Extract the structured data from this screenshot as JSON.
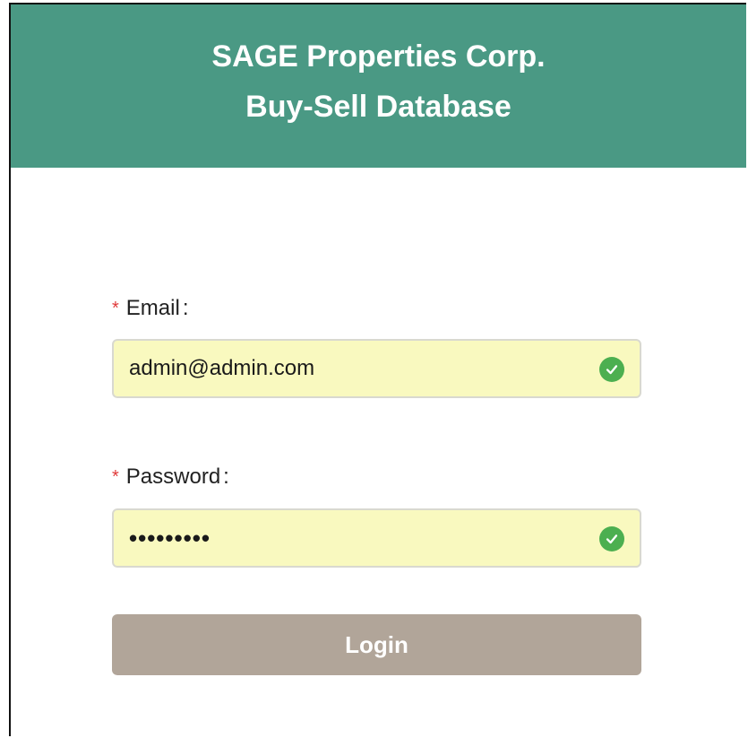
{
  "header": {
    "title_line1": "SAGE Properties Corp.",
    "title_line2": "Buy-Sell Database"
  },
  "form": {
    "email": {
      "required_marker": "*",
      "label": "Email",
      "colon": ":",
      "value": "admin@admin.com",
      "valid_icon": "check-circle-icon"
    },
    "password": {
      "required_marker": "*",
      "label": "Password",
      "colon": ":",
      "value": "•••••••••",
      "valid_icon": "check-circle-icon"
    },
    "login_label": "Login"
  },
  "colors": {
    "header_bg": "#4a9984",
    "input_bg": "#f9f9bf",
    "valid_green": "#4caf50",
    "required_red": "#e03a3a",
    "button_bg": "#b1a599"
  }
}
